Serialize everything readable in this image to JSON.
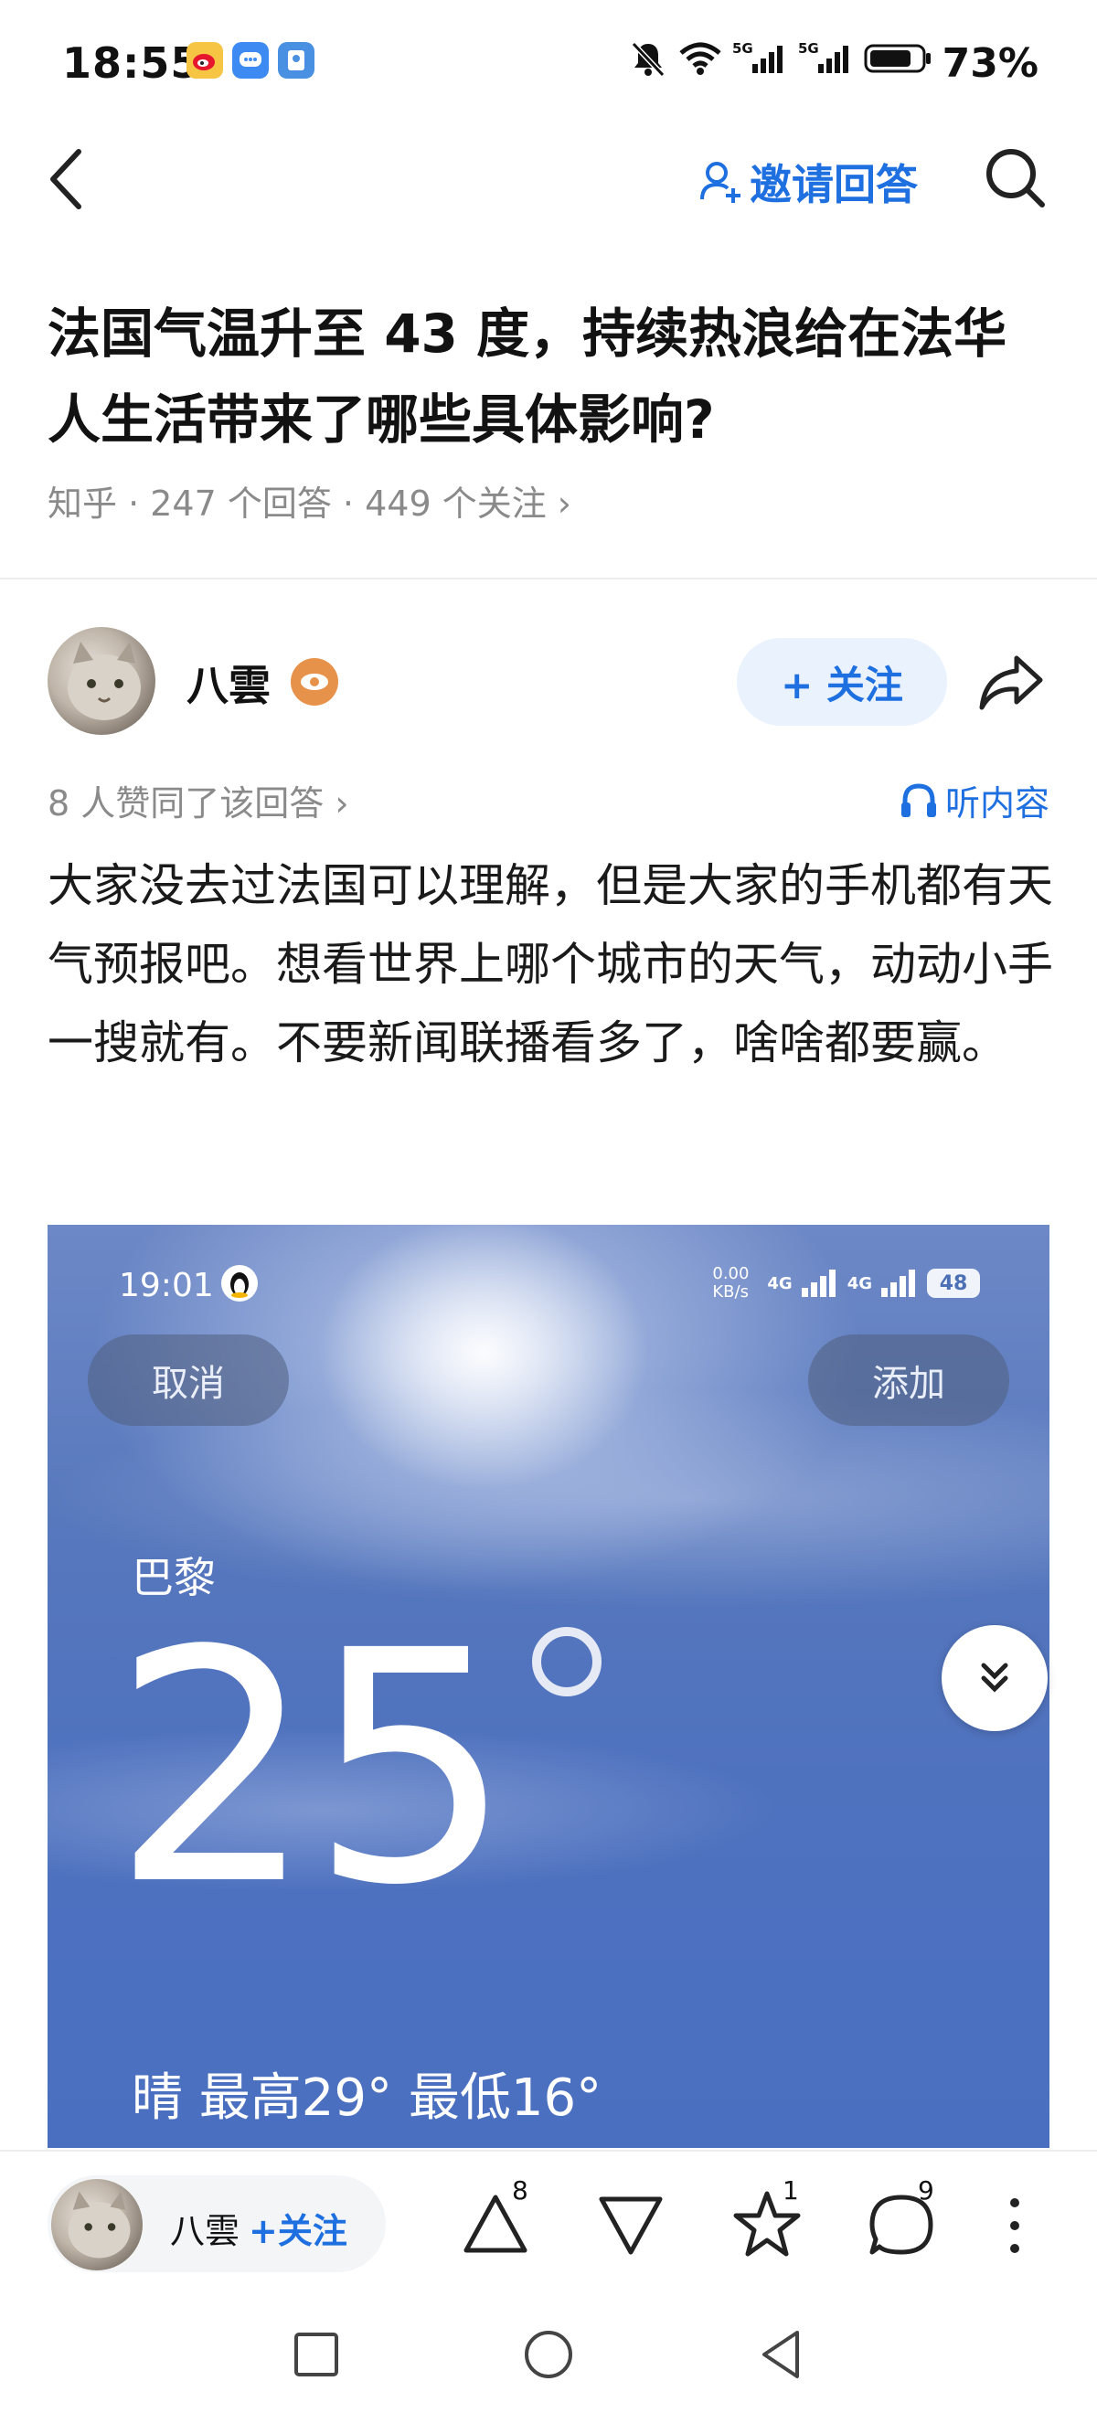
{
  "status_bar": {
    "time": "18:55",
    "battery": "73%",
    "icons": [
      "weibo-icon",
      "chat-icon",
      "wallet-icon",
      "mute-icon",
      "wifi-icon",
      "signal-5g-icon",
      "signal-5g-icon",
      "battery-icon"
    ]
  },
  "nav": {
    "back_icon": "chevron-left-icon",
    "invite_label": "邀请回答",
    "search_icon": "search-icon"
  },
  "question": {
    "title": "法国气温升至 43 度，持续热浪给在法华人生活带来了哪些具体影响?",
    "meta": "知乎 · 247 个回答 · 449 个关注 ›"
  },
  "answer": {
    "author": "八雲",
    "follow_label": "+ 关注",
    "likes": "8 人赞同了该回答 ›",
    "listen_label": "听内容",
    "text": "大家没去过法国可以理解，但是大家的手机都有天气预报吧。想看世界上哪个城市的天气，动动小手一搜就有。不要新闻联播看多了，啥啥都要赢。"
  },
  "weather_image": {
    "time": "19:01",
    "net_speed": "0.00 KB/s",
    "network_1": "4G",
    "network_2": "4G",
    "battery": "48",
    "cancel_label": "取消",
    "add_label": "添加",
    "city": "巴黎",
    "temperature": "25",
    "condition": "晴   最高29° 最低16°"
  },
  "bottom_bar": {
    "author": "八雲",
    "follow_label": "+关注",
    "upvote_count": "8",
    "favorite_count": "1",
    "comment_count": "9"
  },
  "colors": {
    "accent": "#1e6fe0",
    "meta_gray": "#8a8a8a",
    "follow_bg": "#eaf2fd",
    "badge": "#e7924a"
  }
}
